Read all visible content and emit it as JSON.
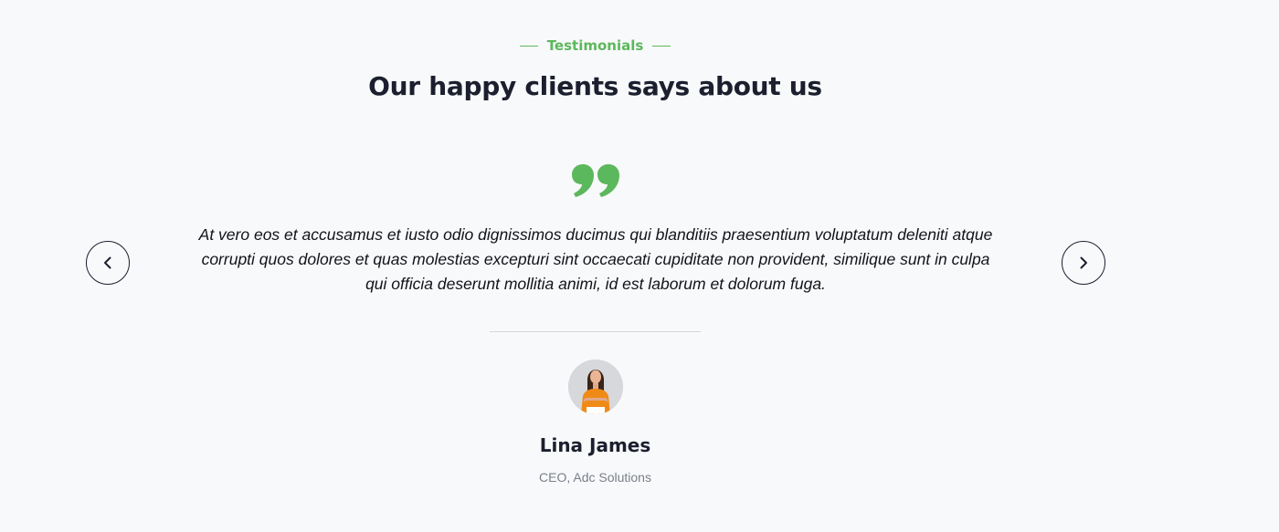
{
  "section": {
    "eyebrow": "Testimonials",
    "title": "Our happy clients says about us"
  },
  "testimonial": {
    "quote": "At vero eos et accusamus et iusto odio dignissimos ducimus qui blanditiis praesentium voluptatum deleniti atque corrupti quos dolores et quas molestias excepturi sint occaecati cupiditate non provident, similique sunt in culpa qui officia deserunt mollitia animi, id est laborum et dolorum fuga.",
    "author_name": "Lina James",
    "author_role": "CEO, Adc Solutions"
  },
  "icons": {
    "quote": "quote-icon",
    "prev": "chevron-left-icon",
    "next": "chevron-right-icon"
  },
  "colors": {
    "accent": "#5cb85c",
    "heading": "#1b1f2e",
    "background": "#f8f9fb",
    "muted": "#7a7f87"
  }
}
